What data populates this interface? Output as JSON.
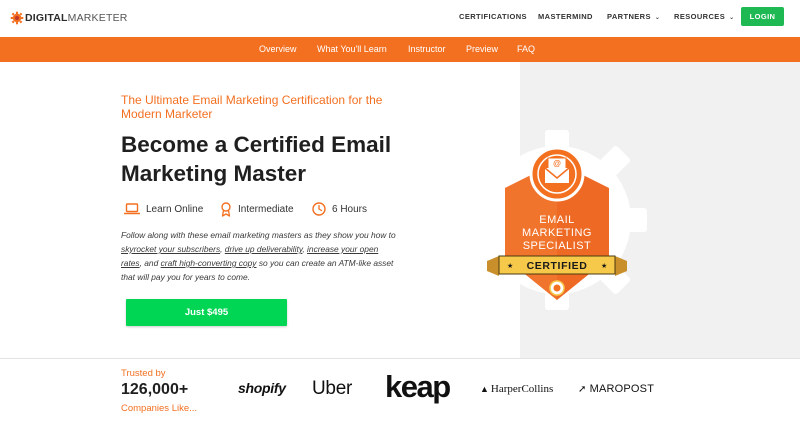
{
  "logo": {
    "word1": "DIGITAL",
    "word2": "MARKETER"
  },
  "nav": {
    "certifications": "CERTIFICATIONS",
    "mastermind": "MASTERMIND",
    "partners": "PARTNERS",
    "resources": "RESOURCES",
    "login": "LOGIN"
  },
  "subnav": [
    "Overview",
    "What You'll Learn",
    "Instructor",
    "Preview",
    "FAQ"
  ],
  "hero": {
    "eyebrow": "The Ultimate Email Marketing Certification for the Modern Marketer",
    "headline": "Become a Certified Email Marketing Master",
    "meta": {
      "format": "Learn Online",
      "level": "Intermediate",
      "duration": "6 Hours"
    },
    "desc": {
      "p1": "Follow along with these email marketing masters as they show you how to ",
      "l1": "skyrocket your subscribers",
      "p2": ", ",
      "l2": "drive up deliverability",
      "p3": ", ",
      "l3": "increase your open rates",
      "p4": ", and ",
      "l4": "craft high-converting copy",
      "p5": " so you can create an ATM-like asset that will pay you for years to come."
    },
    "cta": "Just $495"
  },
  "badge": {
    "line1": "EMAIL",
    "line2": "MARKETING",
    "line3": "SPECIALIST",
    "ribbon": "CERTIFIED"
  },
  "trust": {
    "line1": "Trusted by",
    "count": "126,000+",
    "line3": "Companies Like...",
    "brands": [
      "shopify",
      "Uber",
      "keap",
      "HarperCollins",
      "MAROPOST"
    ]
  },
  "colors": {
    "accent": "#f37021",
    "cta": "#00d654",
    "login": "#1fb954"
  },
  "icons": [
    "gear-logo-icon",
    "laptop-icon",
    "award-icon",
    "clock-icon",
    "envelope-icon",
    "chevron-down-icon"
  ]
}
